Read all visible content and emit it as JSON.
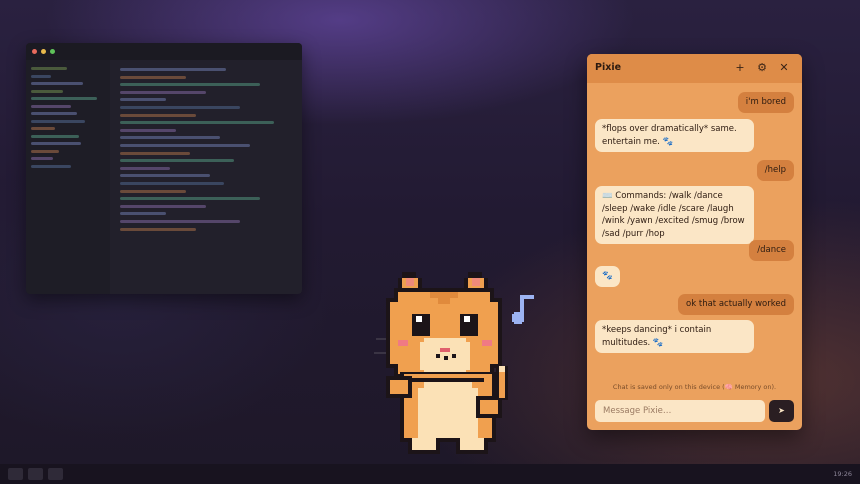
{
  "chat": {
    "title": "Pixie",
    "icons": {
      "new": "plus-icon",
      "settings": "gear-icon",
      "close": "close-icon"
    },
    "messages": [
      {
        "from": "user",
        "text": "i'm bored"
      },
      {
        "from": "pet",
        "text": "*flops over dramatically* same. entertain me. 🐾"
      },
      {
        "from": "user",
        "text": "/help"
      },
      {
        "from": "pet",
        "text": "⌨️ Commands: /walk /dance /sleep /wake /idle /scare /laugh /wink /yawn /excited /smug /brow /sad /purr /hop"
      },
      {
        "from": "user",
        "text": "/dance"
      },
      {
        "from": "pet",
        "text": "🐾"
      },
      {
        "from": "user",
        "text": "ok that actually worked"
      },
      {
        "from": "pet",
        "text": "*keeps dancing* i contain multitudes. 🐾"
      }
    ],
    "privacy_note": "Chat is saved only on this device (🧠 Memory on).",
    "input": {
      "value": "",
      "placeholder": "Message Pixie…"
    },
    "send_icon": "send-icon"
  },
  "pet": {
    "note_icon": "music-note-icon"
  },
  "taskbar": {
    "clock": "19:26"
  },
  "colors": {
    "chat_bg": "#eba15e",
    "chat_header": "#de8c48",
    "user_bubble": "#d4803f",
    "pet_bubble": "#fbe6c6",
    "send_button": "#2a1e22",
    "cat_orange": "#f0a04f",
    "music_note": "#9cb3f2"
  }
}
